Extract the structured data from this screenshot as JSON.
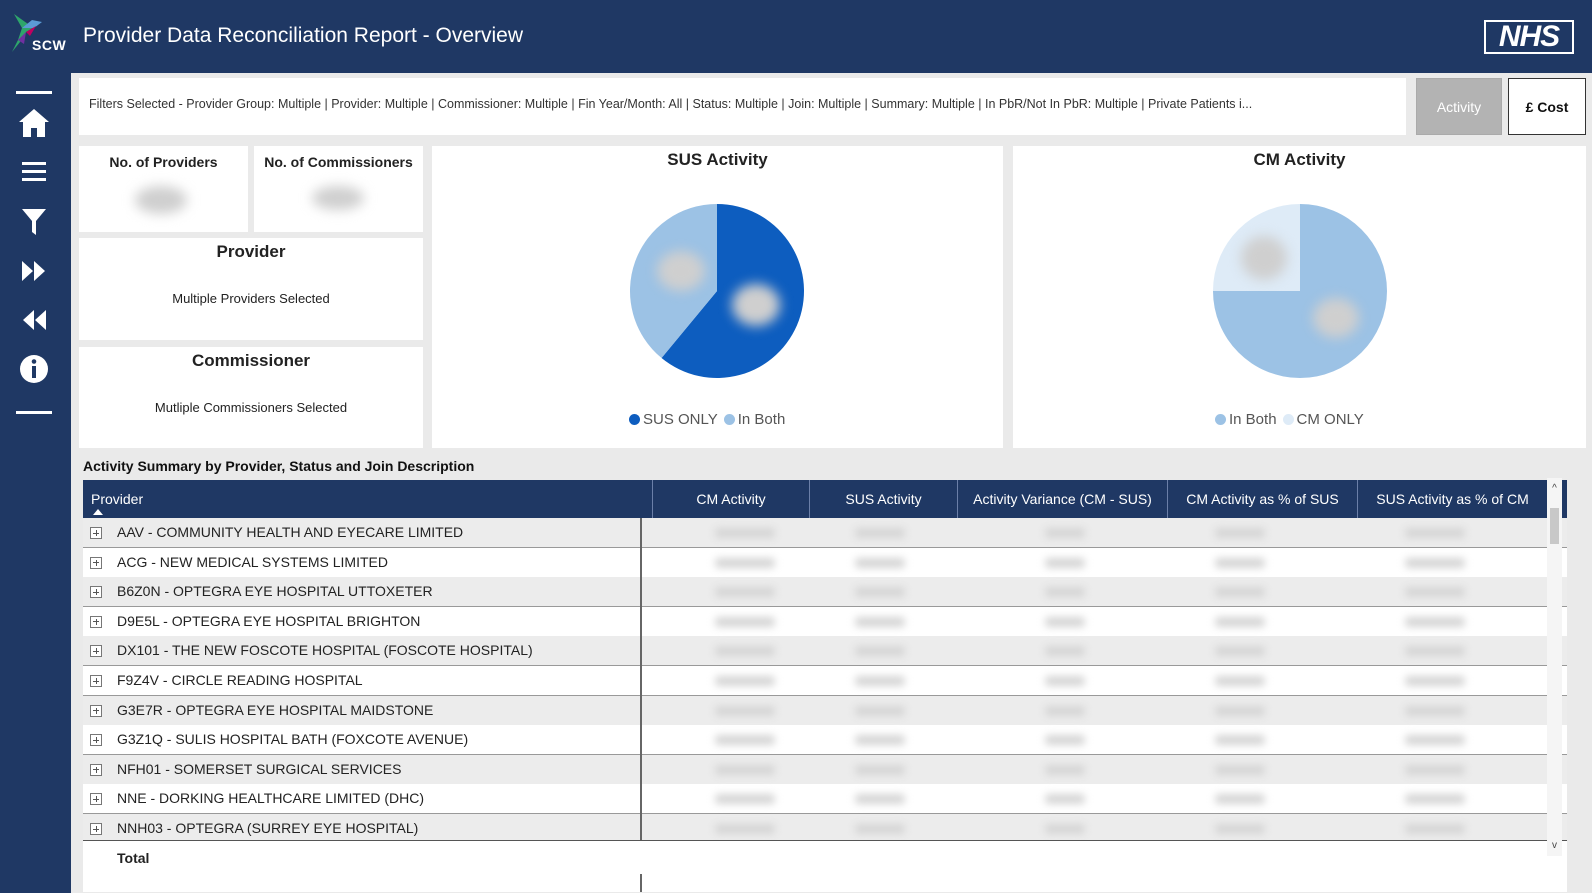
{
  "header": {
    "logo_text": "SCW",
    "title": "Provider Data Reconciliation Report - Overview",
    "brand_badge": "NHS"
  },
  "nav": {
    "items": [
      "home-icon",
      "menu-icon",
      "filter-icon",
      "fast-forward-icon",
      "rewind-icon",
      "info-icon"
    ]
  },
  "filters": {
    "text": "Filters Selected - Provider Group: Multiple | Provider: Multiple | Commissioner: Multiple | Fin Year/Month: All | Status: Multiple | Join: Multiple | Summary: Multiple | In PbR/Not In PbR: Multiple | Private Patients i...",
    "toggle_activity": "Activity",
    "toggle_cost": "£ Cost"
  },
  "kpis": {
    "providers_label": "No. of Providers",
    "commissioners_label": "No. of Commissioners"
  },
  "provider_card": {
    "title": "Provider",
    "value": "Multiple Providers Selected"
  },
  "commissioner_card": {
    "title": "Commissioner",
    "value": "Mutliple Commissioners Selected"
  },
  "sus_chart": {
    "title": "SUS Activity",
    "legend": [
      "SUS ONLY",
      "In Both"
    ]
  },
  "cm_chart": {
    "title": "CM Activity",
    "legend": [
      "In Both",
      "CM ONLY"
    ]
  },
  "colors": {
    "navy": "#1f3864",
    "sus_only": "#0d5dbf",
    "in_both": "#9cc2e5",
    "cm_only": "#deebf7"
  },
  "chart_data": [
    {
      "type": "pie",
      "title": "SUS Activity",
      "slices": [
        {
          "name": "SUS ONLY",
          "share": 0.61
        },
        {
          "name": "In Both",
          "share": 0.39
        }
      ]
    },
    {
      "type": "pie",
      "title": "CM Activity",
      "slices": [
        {
          "name": "In Both",
          "share": 0.75
        },
        {
          "name": "CM ONLY",
          "share": 0.25
        }
      ]
    }
  ],
  "table": {
    "title": "Activity Summary by Provider, Status and Join Description",
    "columns": [
      "Provider",
      "CM Activity",
      "SUS Activity",
      "Activity Variance (CM - SUS)",
      "CM Activity as % of SUS",
      "SUS Activity as % of CM"
    ],
    "rows": [
      "AAV - COMMUNITY HEALTH AND EYECARE LIMITED",
      "ACG - NEW MEDICAL SYSTEMS LIMITED",
      "B6Z0N - OPTEGRA EYE HOSPITAL UTTOXETER",
      "D9E5L - OPTEGRA EYE HOSPITAL BRIGHTON",
      "DX101 - THE NEW FOSCOTE HOSPITAL (FOSCOTE HOSPITAL)",
      "F9Z4V - CIRCLE READING HOSPITAL",
      "G3E7R - OPTEGRA EYE HOSPITAL MAIDSTONE",
      "G3Z1Q - SULIS HOSPITAL BATH (FOXCOTE AVENUE)",
      "NFH01 - SOMERSET SURGICAL SERVICES",
      "NNE - DORKING HEALTHCARE LIMITED (DHC)",
      "NNH03 - OPTEGRA (SURREY EYE HOSPITAL)"
    ],
    "total_label": "Total"
  }
}
